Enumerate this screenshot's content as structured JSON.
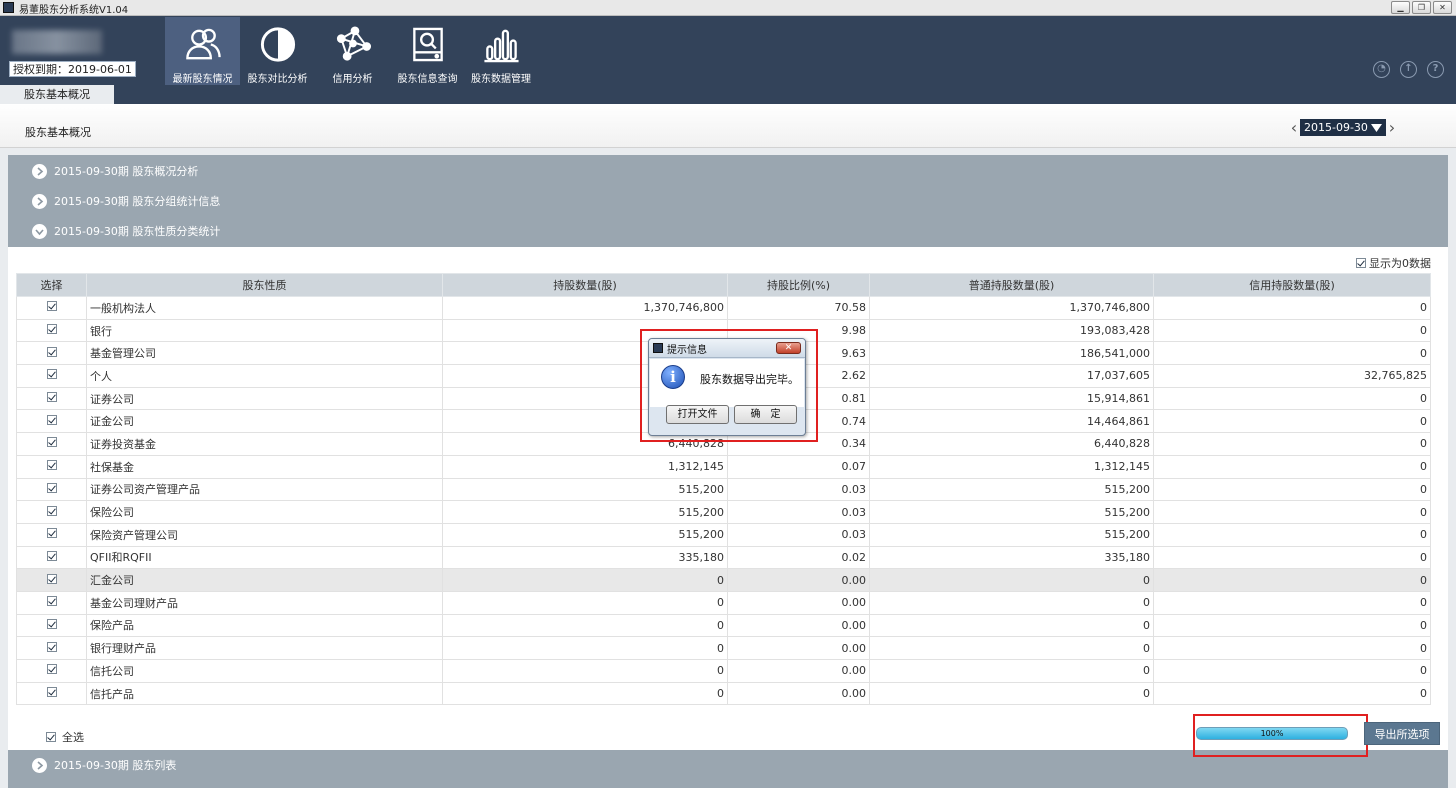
{
  "window": {
    "title": "易董股东分析系统V1.04",
    "buttons": [
      "▁",
      "❐",
      "✕"
    ]
  },
  "header": {
    "license": "授权到期：2019-06-01",
    "nav": [
      {
        "label": "最新股东情况",
        "icon": "users-icon",
        "active": true
      },
      {
        "label": "股东对比分析",
        "icon": "half-circle-icon",
        "active": false
      },
      {
        "label": "信用分析",
        "icon": "network-icon",
        "active": false
      },
      {
        "label": "股东信息查询",
        "icon": "search-drive-icon",
        "active": false
      },
      {
        "label": "股东数据管理",
        "icon": "bar-chart-icon",
        "active": false
      }
    ],
    "tab": "股东基本概况"
  },
  "subheader": {
    "title": "股东基本概况",
    "date": "2015-09-30"
  },
  "accordion": [
    "2015-09-30期 股东概况分析",
    "2015-09-30期 股东分组统计信息",
    "2015-09-30期 股东性质分类统计",
    "2015-09-30期 股东列表"
  ],
  "show_zero": "显示为0数据",
  "table": {
    "headers": [
      "选择",
      "股东性质",
      "持股数量(股)",
      "持股比例(%)",
      "普通持股数量(股)",
      "信用持股数量(股)"
    ],
    "rows": [
      [
        "一般机构法人",
        "1,370,746,800",
        "70.58",
        "1,370,746,800",
        "0"
      ],
      [
        "银行",
        "",
        "9.98",
        "193,083,428",
        "0"
      ],
      [
        "基金管理公司",
        "",
        "9.63",
        "186,541,000",
        "0"
      ],
      [
        "个人",
        "",
        "2.62",
        "17,037,605",
        "32,765,825"
      ],
      [
        "证券公司",
        "",
        "0.81",
        "15,914,861",
        "0"
      ],
      [
        "证金公司",
        "",
        "0.74",
        "14,464,861",
        "0"
      ],
      [
        "证券投资基金",
        "6,440,828",
        "0.34",
        "6,440,828",
        "0"
      ],
      [
        "社保基金",
        "1,312,145",
        "0.07",
        "1,312,145",
        "0"
      ],
      [
        "证券公司资产管理产品",
        "515,200",
        "0.03",
        "515,200",
        "0"
      ],
      [
        "保险公司",
        "515,200",
        "0.03",
        "515,200",
        "0"
      ],
      [
        "保险资产管理公司",
        "515,200",
        "0.03",
        "515,200",
        "0"
      ],
      [
        "QFII和RQFII",
        "335,180",
        "0.02",
        "335,180",
        "0"
      ],
      [
        "汇金公司",
        "0",
        "0.00",
        "0",
        "0"
      ],
      [
        "基金公司理财产品",
        "0",
        "0.00",
        "0",
        "0"
      ],
      [
        "保险产品",
        "0",
        "0.00",
        "0",
        "0"
      ],
      [
        "银行理财产品",
        "0",
        "0.00",
        "0",
        "0"
      ],
      [
        "信托公司",
        "0",
        "0.00",
        "0",
        "0"
      ],
      [
        "信托产品",
        "0",
        "0.00",
        "0",
        "0"
      ]
    ],
    "highlight_row": 12
  },
  "select_all": "全选",
  "progress": {
    "value": 1.0,
    "label": "100%"
  },
  "export_button": "导出所选项",
  "dialog": {
    "title": "提示信息",
    "message": "股东数据导出完毕。",
    "open_button": "打开文件",
    "ok_button": "确　定",
    "close": "✕",
    "icon": "i"
  },
  "header_icons": [
    "user-icon",
    "upload-icon",
    "help-icon"
  ]
}
